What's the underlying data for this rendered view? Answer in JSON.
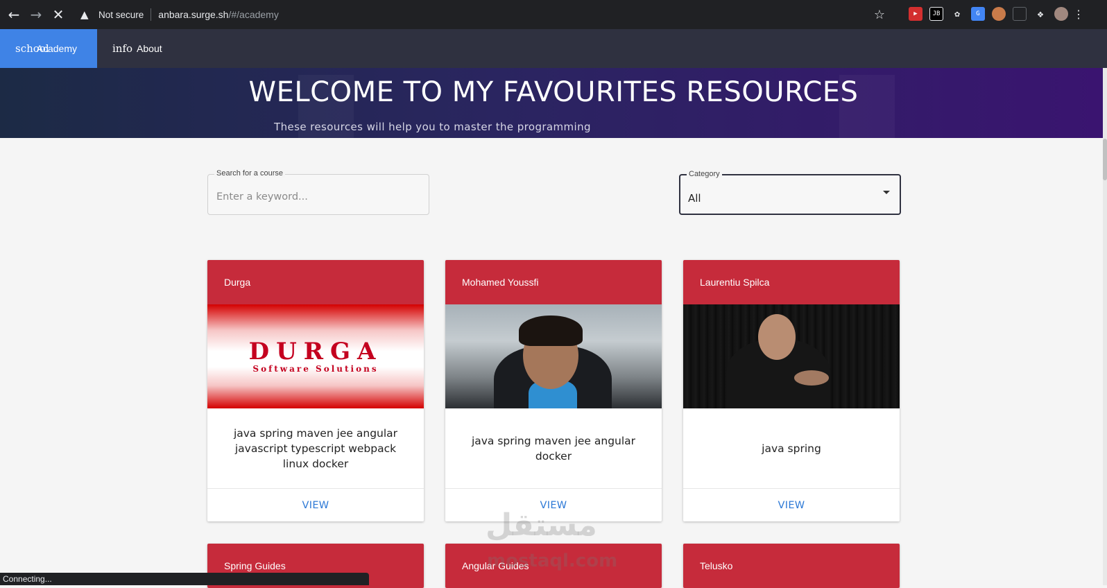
{
  "browser": {
    "security_label": "Not secure",
    "url_host": "anbara.surge.sh",
    "url_path": "/#/academy",
    "status_text": "Connecting..."
  },
  "nav": {
    "items": [
      {
        "icon_text": "school",
        "label": "Academy"
      },
      {
        "icon_text": "info",
        "label": "About"
      }
    ]
  },
  "hero": {
    "title": "WELCOME TO MY FAVOURITES RESOURCES",
    "subtitle": "These resources will help you to master the programming"
  },
  "filters": {
    "search_label": "Search for a course",
    "search_placeholder": "Enter a keyword...",
    "category_label": "Category",
    "category_value": "All"
  },
  "cards": [
    {
      "title": "Durga",
      "tags": "java spring maven jee angular javascript typescript webpack linux docker",
      "action": "VIEW",
      "logo": "DURGA",
      "logo_tagline": "Software Solutions"
    },
    {
      "title": "Mohamed Youssfi",
      "tags": "java spring maven jee angular docker",
      "action": "VIEW"
    },
    {
      "title": "Laurentiu Spilca",
      "tags": "java spring",
      "action": "VIEW"
    },
    {
      "title": "Spring Guides"
    },
    {
      "title": "Angular Guides"
    },
    {
      "title": "Telusko"
    }
  ],
  "watermark": {
    "arabic": "مستقل",
    "latin": "mostaql.com"
  }
}
